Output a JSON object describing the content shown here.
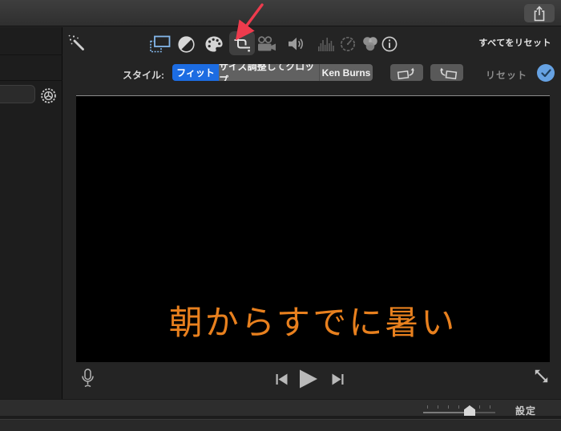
{
  "titlebar": {
    "share_icon": "share-icon"
  },
  "toolbar": {
    "reset_all_label": "すべてをリセット",
    "icons": [
      {
        "name": "enhance-wand",
        "state": "normal"
      },
      {
        "name": "overlay-settings",
        "state": "active-blue"
      },
      {
        "name": "color-balance",
        "state": "normal"
      },
      {
        "name": "color-filters",
        "state": "normal"
      },
      {
        "name": "crop",
        "state": "selected"
      },
      {
        "name": "stabilization",
        "state": "dimmed"
      },
      {
        "name": "volume",
        "state": "normal"
      },
      {
        "name": "noise-equalizer",
        "state": "dimmed"
      },
      {
        "name": "speed",
        "state": "dimmed"
      },
      {
        "name": "color-correction",
        "state": "normal"
      },
      {
        "name": "info",
        "state": "normal"
      }
    ]
  },
  "style_bar": {
    "label": "スタイル:",
    "segments": [
      {
        "label": "フィット",
        "selected": true
      },
      {
        "label": "サイズ調整してクロップ",
        "selected": false
      },
      {
        "label": "Ken Burns",
        "selected": false
      }
    ],
    "reset_label": "リセット",
    "applied_check": true
  },
  "preview": {
    "caption": "朝からすでに暑い",
    "caption_color": "#e8801e"
  },
  "transport": {
    "icons": [
      "microphone",
      "skip-back",
      "play",
      "skip-forward",
      "fullscreen-expand"
    ]
  },
  "bottom_bar": {
    "settings_label": "設定",
    "zoom_slider_value": 0.64
  },
  "colors": {
    "accent_blue": "#1c6ce2",
    "check_blue": "#66a2e3",
    "arrow_red": "#ee3b4d",
    "caption_orange": "#e8801e"
  }
}
